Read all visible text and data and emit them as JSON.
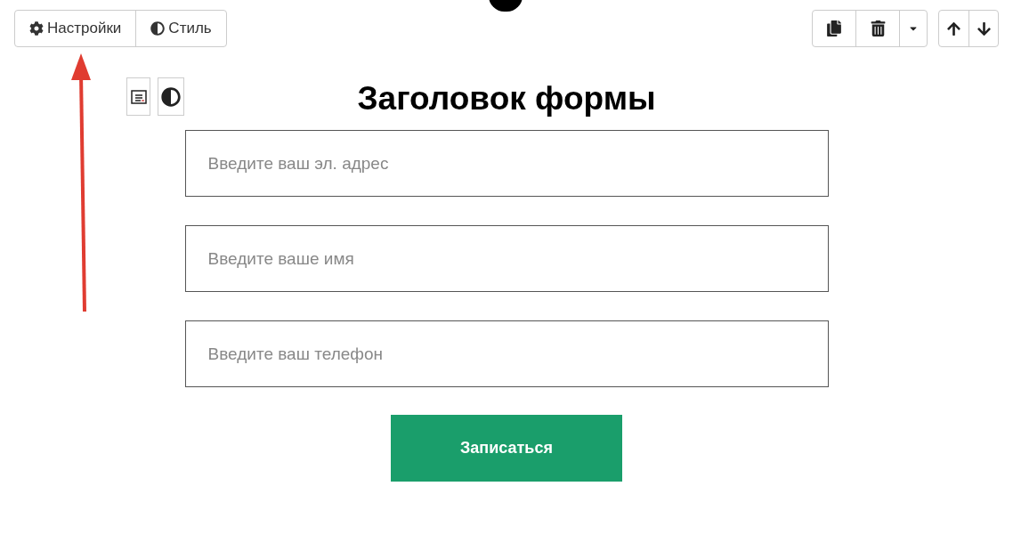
{
  "toolbar": {
    "tabs": [
      {
        "label": "Настройки"
      },
      {
        "label": "Стиль"
      }
    ]
  },
  "form": {
    "title": "Заголовок формы",
    "fields": [
      {
        "placeholder": "Введите ваш эл. адрес"
      },
      {
        "placeholder": "Введите ваше имя"
      },
      {
        "placeholder": "Введите ваш телефон"
      }
    ],
    "submit": "Записаться"
  }
}
